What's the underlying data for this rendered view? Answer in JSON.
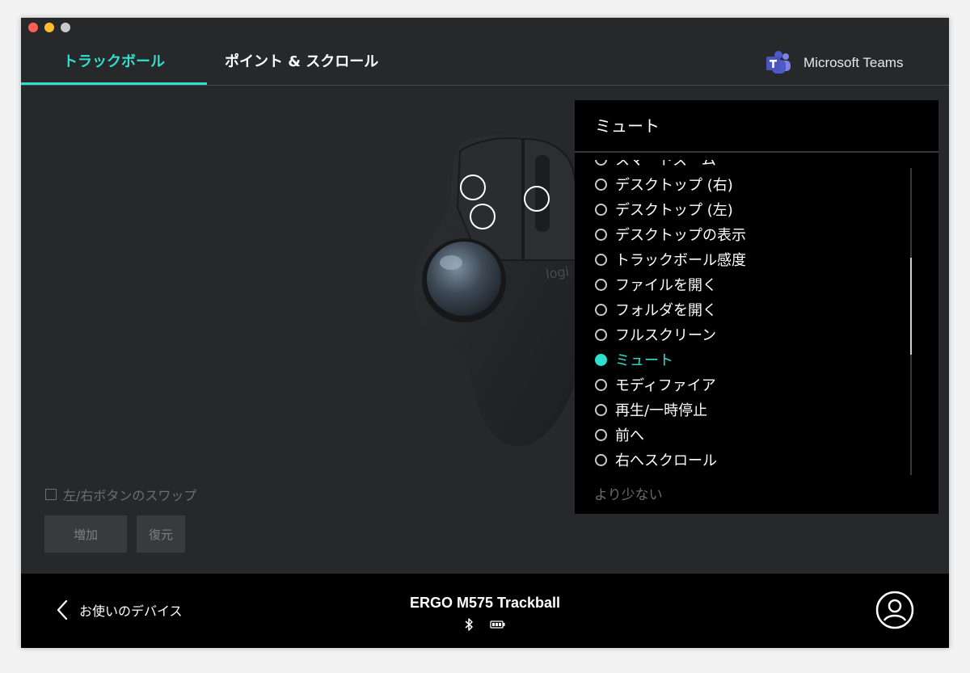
{
  "window": {
    "traffic_lights": [
      "#fe5f57",
      "#febc2e",
      "#c9c9c9"
    ]
  },
  "tabs": [
    {
      "label": "トラックボール",
      "active": true
    },
    {
      "label": "ポイント & スクロール",
      "active": false
    }
  ],
  "accent_color": "#2ee0d0",
  "app_profile": {
    "icon": "microsoft-teams-icon",
    "label": "Microsoft Teams"
  },
  "device_image": {
    "logo_text": "logi"
  },
  "action_panel": {
    "title": "ミュート",
    "options": [
      {
        "label": "スマートズーム",
        "selected": false
      },
      {
        "label": "デスクトップ (右)",
        "selected": false
      },
      {
        "label": "デスクトップ (左)",
        "selected": false
      },
      {
        "label": "デスクトップの表示",
        "selected": false
      },
      {
        "label": "トラックボール感度",
        "selected": false
      },
      {
        "label": "ファイルを開く",
        "selected": false
      },
      {
        "label": "フォルダを開く",
        "selected": false
      },
      {
        "label": "フルスクリーン",
        "selected": false
      },
      {
        "label": "ミュート",
        "selected": true
      },
      {
        "label": "モディファイア",
        "selected": false
      },
      {
        "label": "再生/一時停止",
        "selected": false
      },
      {
        "label": "前へ",
        "selected": false
      },
      {
        "label": "右へスクロール",
        "selected": false
      }
    ],
    "less_label": "より少ない"
  },
  "swap_checkbox": {
    "label": "左/右ボタンのスワップ",
    "checked": false
  },
  "buttons": {
    "add": "増加",
    "restore": "復元"
  },
  "footer": {
    "back_label": "お使いのデバイス",
    "device_name": "ERGO M575 Trackball",
    "status_icons": [
      "bluetooth-icon",
      "battery-icon"
    ],
    "user_icon": "user-icon"
  }
}
